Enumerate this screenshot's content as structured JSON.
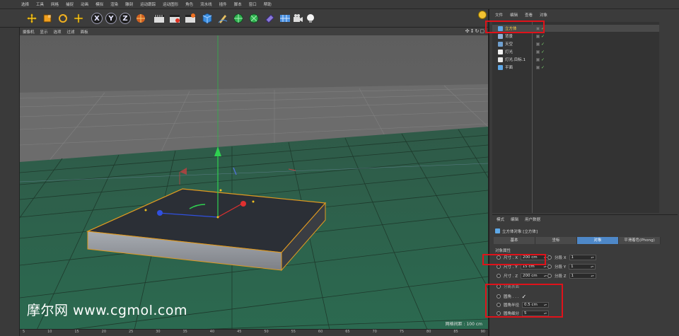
{
  "menubar": {
    "items": [
      "选择",
      "工具",
      "网格",
      "捕捉",
      "动画",
      "模拟",
      "渲染",
      "雕刻",
      "运动跟踪",
      "运动图形",
      "角色",
      "流水线",
      "插件",
      "脚本",
      "窗口",
      "帮助"
    ]
  },
  "toolbar": {
    "axis_x": "X",
    "axis_y": "Y",
    "axis_z": "Z",
    "icons": [
      "move-tool-icon",
      "scale-tool-icon",
      "rotate-tool-icon",
      "create-tool-icon",
      "coordinate-system-icon",
      "render-view-icon",
      "render-picture-icon",
      "edit-render-settings-icon",
      "cube-icon",
      "pen-icon",
      "subdivision-icon",
      "deformer-icon",
      "tag-icon",
      "environment-icon",
      "camera-icon",
      "light-icon"
    ]
  },
  "viewport": {
    "menus": [
      "摄像机",
      "显示",
      "选项",
      "过滤",
      "面板"
    ],
    "nav_glyphs": "✣↕↻▢",
    "grid_readout": "网格间距 : 100 cm",
    "watermark": "摩尔网 www.cgmol.com"
  },
  "timeline": {
    "ticks": [
      "5",
      "10",
      "15",
      "20",
      "25",
      "30",
      "35",
      "40",
      "45",
      "50",
      "55",
      "60",
      "65",
      "70",
      "75",
      "80",
      "85",
      "90"
    ]
  },
  "object_manager": {
    "tabs": [
      "文件",
      "编辑",
      "查看",
      "对象"
    ],
    "objects": [
      {
        "name": "立方体",
        "icon": "cube-icon",
        "selected": true
      },
      {
        "name": "背景",
        "icon": "background-icon",
        "selected": false
      },
      {
        "name": "天空",
        "icon": "sky-icon",
        "selected": false
      },
      {
        "name": "灯光",
        "icon": "light-icon",
        "selected": false
      },
      {
        "name": "灯光.目标.1",
        "icon": "target-light-icon",
        "selected": false
      },
      {
        "name": "平面",
        "icon": "plane-icon",
        "selected": false
      }
    ]
  },
  "attributes": {
    "mode_tabs": [
      "模式",
      "编辑",
      "用户数据"
    ],
    "title": "立方体对象 [立方体]",
    "tabs": [
      "基本",
      "坐标",
      "对象",
      "平滑着色(Phong)"
    ],
    "active_tab": "对象",
    "section": "对象属性",
    "size_x_label": "尺寸 . X",
    "size_x": "200 cm",
    "size_y_label": "尺寸 . Y",
    "size_y": "15 cm",
    "size_z_label": "尺寸 . Z",
    "size_z": "200 cm",
    "seg_x_label": "分段 X",
    "seg_x": "1",
    "seg_y_label": "分段 Y",
    "seg_y": "1",
    "seg_z_label": "分段 Z",
    "seg_z": "1",
    "separate_surfaces_label": "分离表面",
    "fillet_label": "圆角 . . .",
    "fillet_checked": "✓",
    "fillet_radius_label": "圆角半径",
    "fillet_radius": "0.5 cm",
    "fillet_subdivision_label": "圆角细分",
    "fillet_subdivision": "5"
  }
}
